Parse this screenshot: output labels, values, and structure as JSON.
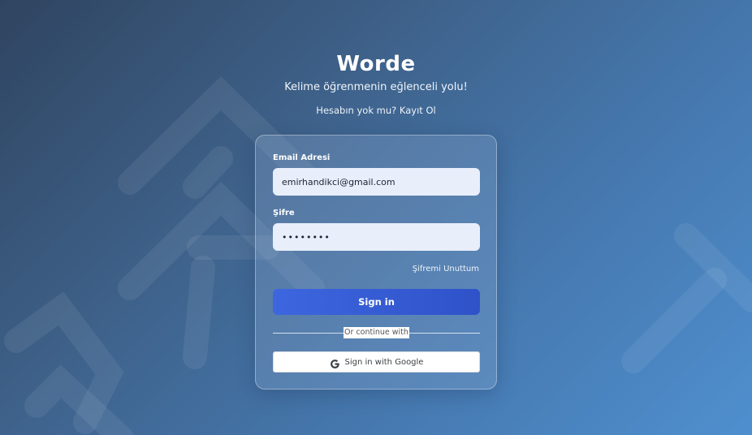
{
  "app": {
    "title": "Worde",
    "tagline": "Kelime öğrenmenin eğlenceli yolu!",
    "signup_prompt": "Hesabın yok mu? Kayıt Ol"
  },
  "form": {
    "email_label": "Email Adresi",
    "email_value": "emirhandikci@gmail.com",
    "password_label": "Şifre",
    "password_value": "••••••••",
    "forgot_label": "Şifremi Unuttum",
    "signin_label": "Sign in",
    "divider_label": "Or continue with",
    "google_label": "Sign in with Google"
  },
  "colors": {
    "background_start": "#2f4460",
    "background_end": "#4f8fcf",
    "signin_button": "#3d66df",
    "input_background": "#e8eefa"
  },
  "icons": {
    "google": "google-icon"
  }
}
